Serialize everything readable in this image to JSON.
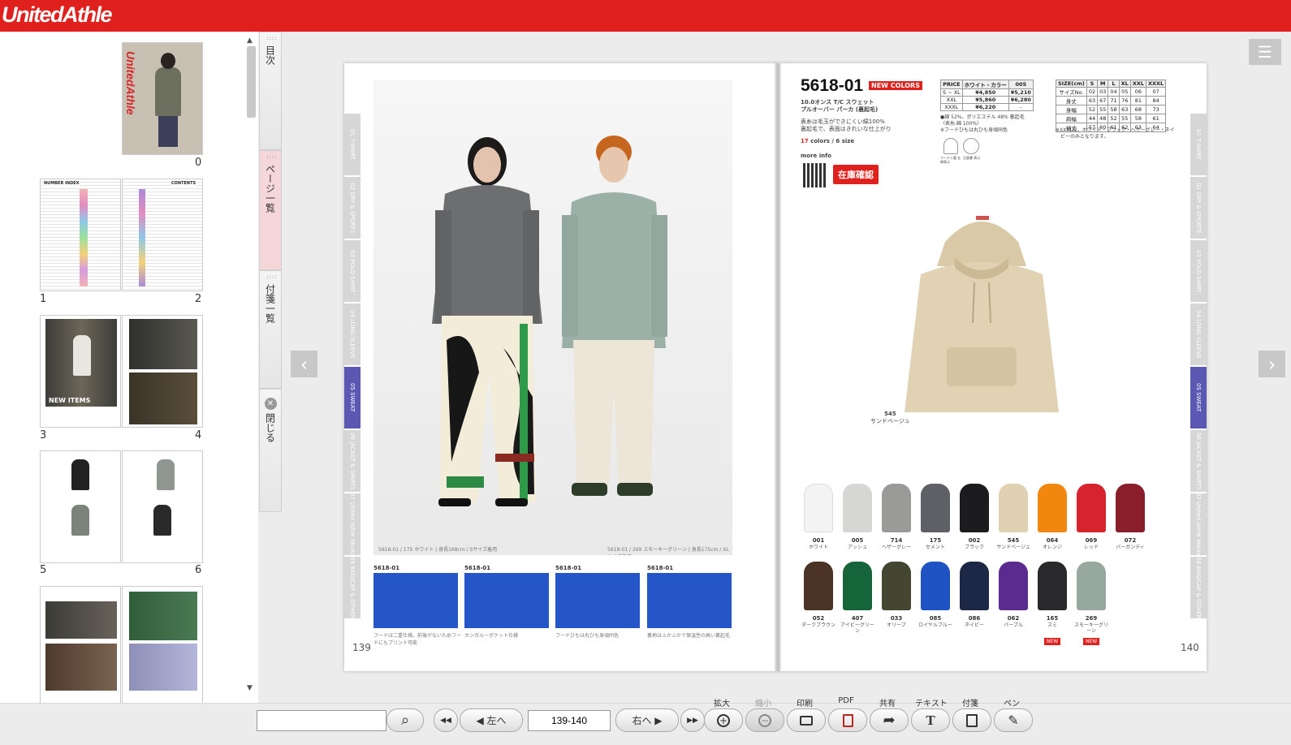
{
  "header": {
    "logo_text": "UnitedAthle",
    "accent": "#e0201c"
  },
  "sidebar": {
    "thumbnails": [
      {
        "label": "0",
        "cover_brand": "UnitedAthle"
      },
      {
        "label": "1",
        "title": "NUMBER INDEX"
      },
      {
        "label": "2",
        "title": "CONTENTS"
      },
      {
        "label": "3",
        "overlay": "NEW ITEMS"
      },
      {
        "label": "4"
      },
      {
        "label": "5"
      },
      {
        "label": "6"
      }
    ],
    "scroll_up": "▲",
    "scroll_down": "▼"
  },
  "side_tabs": {
    "contents": "目次",
    "pagelist": "ページ一覧",
    "sticky": "付箋一覧",
    "close": "閉じる",
    "close_symbol": "✕"
  },
  "viewer": {
    "prev_symbol": "‹",
    "next_symbol": "›",
    "menu_symbol": "☰"
  },
  "spread": {
    "index_tabs": [
      "01 T-SHIRT",
      "02 DRY & SPORTS",
      "03 POLO SHIRT",
      "04 LONG SLEEVE",
      "05 SWEAT",
      "06 JACKET & SHIRTS",
      "07 United Athle Works",
      "08 BAG/CAP & OTHER"
    ],
    "left": {
      "caption_left": "5618-01 / 175 ホワイト | 身長168cm / Sサイズ着用",
      "caption_right": "5618-01 / 269 スモーキーグリーン | 身長175cm / XLサイズ着用",
      "details": [
        {
          "label": "5618-01",
          "text": "フードは二重仕様。前後がないためフードにもプリント可能"
        },
        {
          "label": "5618-01",
          "text": "カンガルーポケット仕様"
        },
        {
          "label": "5618-01",
          "text": "フードひもは丸ひも身頃同色"
        },
        {
          "label": "5618-01",
          "text": "裏地はふかふかで保温性の高い裏起毛"
        }
      ],
      "page_number": "139"
    },
    "right": {
      "product_number": "5618-01",
      "new_colors": "NEW COLORS",
      "name_line1": "10.0オンス T/C スウェット",
      "name_line2": "プルオーバー パーカ (裏起毛)",
      "desc_line1": "表糸は毛玉ができにくい綿100%",
      "desc_line2": "裏起毛で、表面はきれいな仕上がり",
      "colors_count": "17",
      "colors_suffix": "colors / 6 size",
      "more_info": "more info",
      "stock_button": "在庫確認",
      "featured_code": "545",
      "featured_name": "サンドベージュ",
      "price_table": {
        "headers": [
          "PRICE",
          "ホワイト・カラー",
          "005"
        ],
        "rows": [
          [
            "S ~ XL",
            "¥4,850",
            "¥5,210"
          ],
          [
            "XXL",
            "¥5,860",
            "¥6,280"
          ],
          [
            "XXXL",
            "¥6,220",
            "-"
          ]
        ]
      },
      "material_line1": "●綿 52%、ポリエステル 48% 裏起毛",
      "material_line2": "（表糸:綿 100%）",
      "material_line3": "※フードひもは丸ひも身頃同色",
      "size_table": {
        "headers": [
          "SIZE(cm)",
          "S",
          "M",
          "L",
          "XL",
          "XXL",
          "XXXL"
        ],
        "rows": [
          [
            "サイズNo.",
            "02",
            "03",
            "04",
            "05",
            "06",
            "07"
          ],
          [
            "身丈",
            "63",
            "67",
            "71",
            "76",
            "81",
            "84"
          ],
          [
            "身幅",
            "52",
            "55",
            "58",
            "63",
            "68",
            "73"
          ],
          [
            "肩幅",
            "44",
            "48",
            "52",
            "55",
            "58",
            "61"
          ],
          [
            "袖丈",
            "57",
            "60",
            "61",
            "62",
            "63",
            "64"
          ]
        ]
      },
      "size_note_line1": "※XXXLは、ホワイト・ブラック・ヘザーグレー・ネイ",
      "size_note_line2": "ビーのみとなります。",
      "icon_label_1": "フードニ重 仕様表示",
      "icon_label_2": "注意書 表示",
      "swatches_row1": [
        {
          "code": "001",
          "name": "ホワイト",
          "color": "#f3f3f3"
        },
        {
          "code": "005",
          "name": "アッシュ",
          "color": "#d6d6d4"
        },
        {
          "code": "714",
          "name": "ヘザーグレー",
          "color": "#9a9a98"
        },
        {
          "code": "175",
          "name": "セメント",
          "color": "#5e6066"
        },
        {
          "code": "002",
          "name": "ブラック",
          "color": "#1c1c1e"
        },
        {
          "code": "545",
          "name": "サンドベージュ",
          "color": "#dfd1b2"
        },
        {
          "code": "064",
          "name": "オレンジ",
          "color": "#f2870f"
        },
        {
          "code": "069",
          "name": "レッド",
          "color": "#d6232e"
        },
        {
          "code": "072",
          "name": "バーガンディ",
          "color": "#8a1f2b"
        }
      ],
      "swatches_row2": [
        {
          "code": "052",
          "name": "ダークブラウン",
          "color": "#4b3227"
        },
        {
          "code": "407",
          "name": "アイビーグリーン",
          "color": "#16653a"
        },
        {
          "code": "033",
          "name": "オリーブ",
          "color": "#454632"
        },
        {
          "code": "085",
          "name": "ロイヤルブルー",
          "color": "#1f52c2"
        },
        {
          "code": "086",
          "name": "ネイビー",
          "color": "#1d2746"
        },
        {
          "code": "062",
          "name": "パープル",
          "color": "#5b2c8f"
        },
        {
          "code": "165",
          "name": "スミ",
          "color": "#2a2a2c",
          "new": "NEW"
        },
        {
          "code": "269",
          "name": "スモーキーグリーン",
          "color": "#97a89e",
          "new": "NEW"
        }
      ],
      "page_number": "140"
    }
  },
  "toolbar": {
    "search_placeholder": "",
    "search_symbol": "⌕",
    "first_symbol": "◀◀",
    "prev_label": "◀ 左へ",
    "page_value": "139-140",
    "next_label": "右へ ▶",
    "last_symbol": "▶▶",
    "zoom_in_label": "拡大",
    "zoom_out_label": "縮小",
    "print_label": "印刷",
    "pdf_label": "PDF",
    "share_label": "共有",
    "text_label": "テキスト",
    "sticky_label": "付箋",
    "pen_label": "ペン"
  }
}
